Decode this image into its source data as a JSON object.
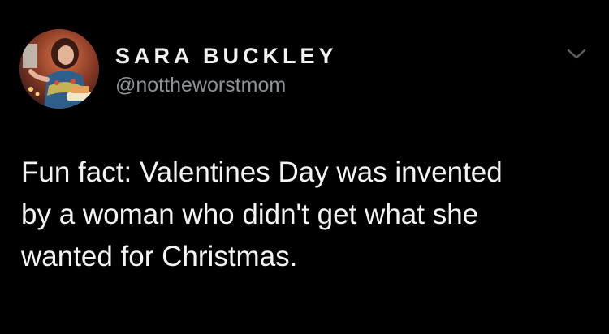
{
  "tweet": {
    "author": {
      "display_name": "SARA BUCKLEY",
      "handle": "@nottheworstmom",
      "avatar_icon": "profile-photo"
    },
    "menu_icon": "chevron-down-icon",
    "text_lines": [
      "Fun fact: Valentines Day was invented",
      "by a woman who didn't get what she",
      "wanted for Christmas."
    ]
  },
  "colors": {
    "background": "#000000",
    "name": "#f2f2f2",
    "handle": "#8e9399",
    "body_text": "#f4f4f4",
    "chevron": "#5b6066"
  }
}
